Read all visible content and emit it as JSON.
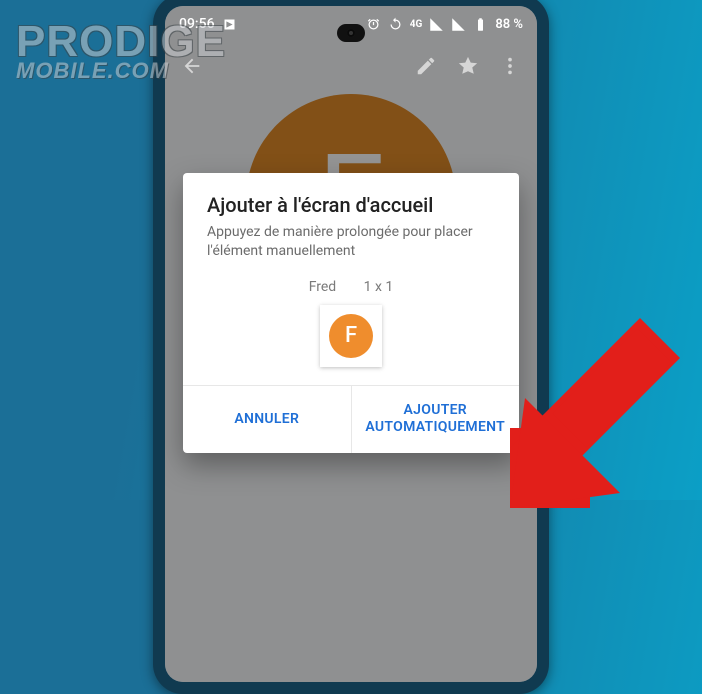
{
  "watermark": {
    "line1": "PRODIGE",
    "line2": "MOBILE.COM"
  },
  "statusbar": {
    "time": "09:56",
    "battery_text": "88 %"
  },
  "contact_hero_initial": "F",
  "dialog": {
    "title": "Ajouter à l'écran d'accueil",
    "subtitle": "Appuyez de manière prolongée pour placer l'élément manuellement",
    "preview_name": "Fred",
    "preview_size": "1 x 1",
    "preview_initial": "F",
    "cancel_label": "ANNULER",
    "confirm_label": "AJOUTER AUTOMATIQUEMENT"
  },
  "colors": {
    "accent_blue": "#1f6fd6",
    "contact_circle": "#e08b29",
    "arrow": "#e21f1a"
  }
}
